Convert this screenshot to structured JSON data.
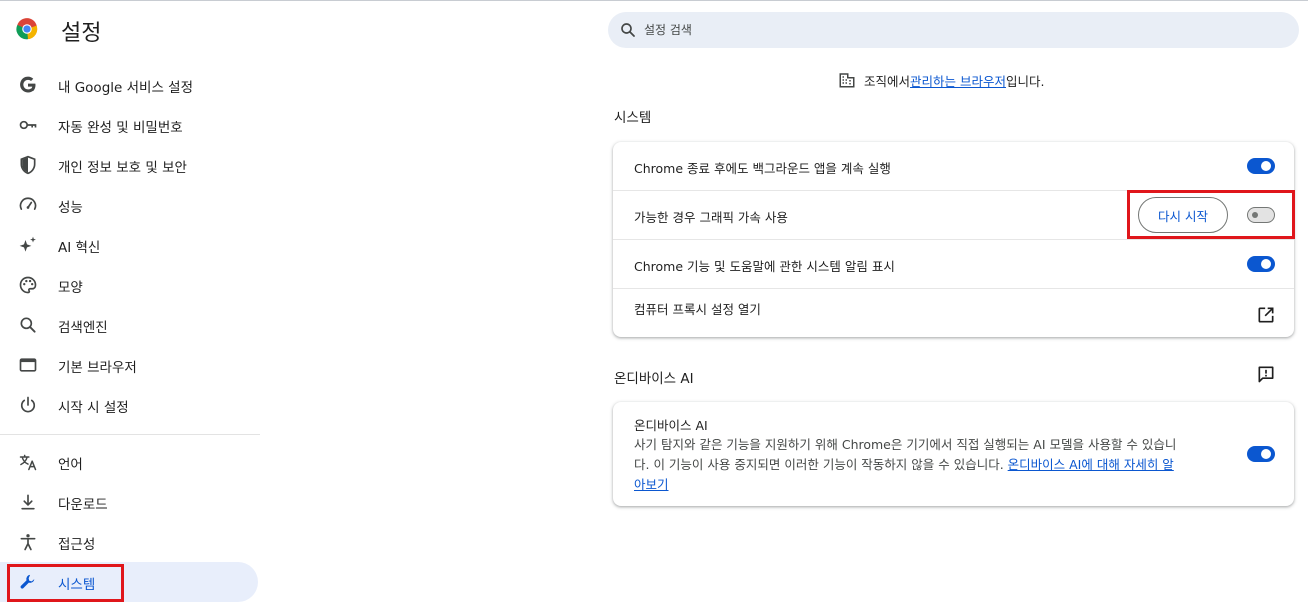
{
  "header": {
    "title": "설정",
    "logo_icon": "chrome-logo-icon"
  },
  "search": {
    "placeholder": "설정 검색",
    "icon": "search-icon"
  },
  "sidebar": {
    "items": [
      {
        "label": "내 Google 서비스 설정",
        "icon": "google-g-icon"
      },
      {
        "label": "자동 완성 및 비밀번호",
        "icon": "key-icon"
      },
      {
        "label": "개인 정보 보호 및 보안",
        "icon": "shield-icon"
      },
      {
        "label": "성능",
        "icon": "speedometer-icon"
      },
      {
        "label": "AI 혁신",
        "icon": "sparkle-icon"
      },
      {
        "label": "모양",
        "icon": "palette-icon"
      },
      {
        "label": "검색엔진",
        "icon": "search-icon"
      },
      {
        "label": "기본 브라우저",
        "icon": "browser-window-icon"
      },
      {
        "label": "시작 시 설정",
        "icon": "power-icon"
      },
      {
        "label": "언어",
        "icon": "translate-icon"
      },
      {
        "label": "다운로드",
        "icon": "download-icon"
      },
      {
        "label": "접근성",
        "icon": "accessibility-icon"
      },
      {
        "label": "시스템",
        "icon": "wrench-icon"
      }
    ],
    "active_index": 12
  },
  "managed": {
    "prefix": "조직에서 ",
    "link": "관리하는 브라우저",
    "suffix": "입니다.",
    "icon": "building-icon"
  },
  "system": {
    "title": "시스템",
    "rows": [
      {
        "label": "Chrome 종료 후에도 백그라운드 앱을 계속 실행",
        "enabled": true
      },
      {
        "label": "가능한 경우 그래픽 가속 사용",
        "enabled": false,
        "button": "다시 시작"
      },
      {
        "label": "Chrome 기능 및 도움말에 관한 시스템 알림 표시",
        "enabled": true
      },
      {
        "label": "컴퓨터 프록시 설정 열기",
        "icon": "open-in-new-icon"
      }
    ]
  },
  "ondevice": {
    "title": "온디바이스 AI",
    "feedback_icon": "feedback-icon",
    "card_title": "온디바이스 AI",
    "desc_line1": "사기 탐지와 같은 기능을 지원하기 위해 Chrome은 기기에서 직접 실행되는 AI 모델을 사용할 수 있습니",
    "desc_line2_text": "다. 이 기능이 사용 중지되면 이러한 기능이 작동하지 않을 수 있습니다. ",
    "desc_link_part1": "온디바이스 AI에 대해 자세히 알",
    "desc_link_part2": "아보기",
    "enabled": true
  },
  "colors": {
    "accent": "#0b57d0",
    "highlight": "#e0161b",
    "active_nav_bg": "#e8eefb",
    "search_bg": "#e9eef6"
  }
}
